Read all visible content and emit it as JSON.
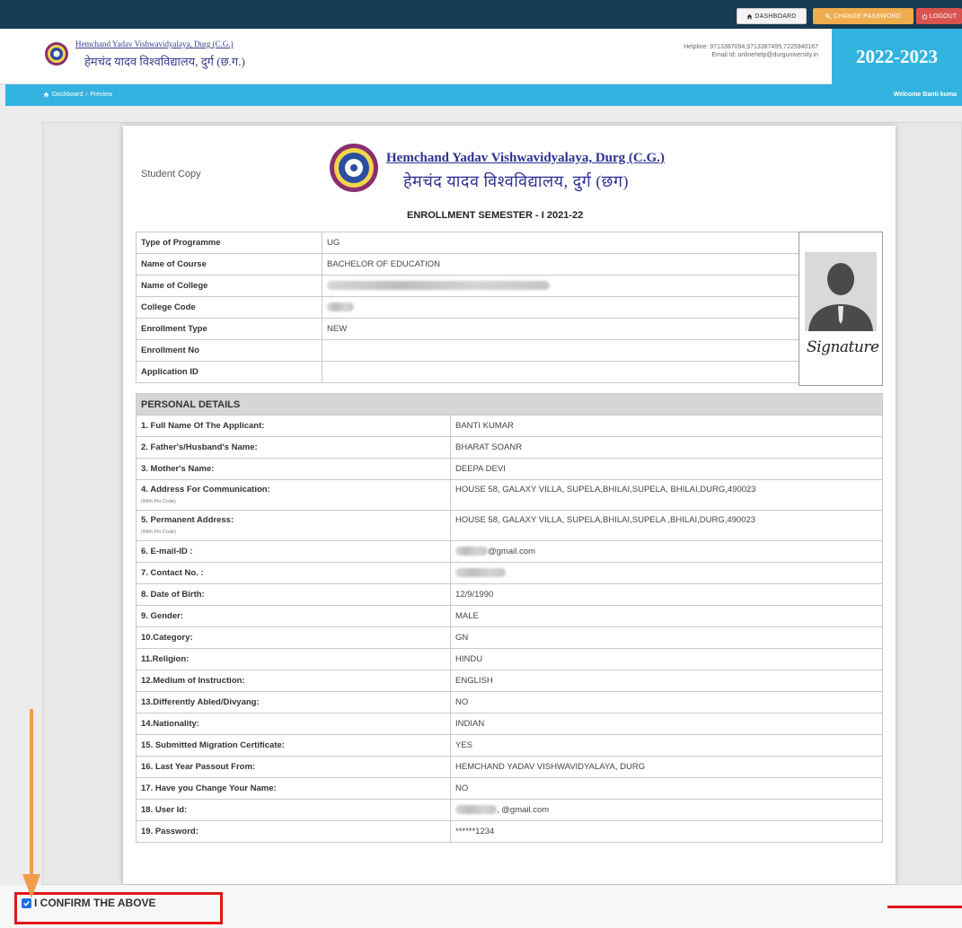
{
  "topbar": {
    "dashboard_label": "DASHBOARD",
    "change_password_label": "CHANGE PASSWORD",
    "logout_label": "LOGOUT"
  },
  "header": {
    "name_en": "Hemchand Yadav Vishwavidyalaya, Durg (C.G.)",
    "name_hi": "हेमचंद यादव विश्वविद्यालय, दुर्ग (छ.ग.)",
    "helpline": "Helpline: 9713387094,9713387495,7225940167",
    "email": "Email Id: onlinehelp@durguniversity.in",
    "year": "2022-2023"
  },
  "breadcrumb": {
    "items": [
      "Dashboard",
      "Preview"
    ],
    "separator": "/",
    "welcome": "Welcome Banti kuma"
  },
  "document": {
    "copy_label": "Student Copy",
    "university_en": "Hemchand Yadav Vishwavidyalaya, Durg (C.G.)",
    "university_hi": "हेमचंद यादव विश्वविद्यालय, दुर्ग (छग)",
    "semester": "ENROLLMENT SEMESTER - I 2021-22",
    "signature": "Signature",
    "info_rows": [
      {
        "label": "Type of Programme",
        "value": "UG"
      },
      {
        "label": "Name of Course",
        "value": "BACHELOR OF EDUCATION"
      },
      {
        "label": "Name of College",
        "value": ""
      },
      {
        "label": "College Code",
        "value": ""
      },
      {
        "label": "Enrollment Type",
        "value": "NEW"
      },
      {
        "label": "Enrollment No",
        "value": ""
      },
      {
        "label": "Application ID",
        "value": ""
      }
    ],
    "personal_heading": "PERSONAL DETAILS",
    "pin_note": "(With Pin Code)",
    "personal_rows": [
      {
        "label": "1. Full Name Of The Applicant:",
        "value": "BANTI  KUMAR"
      },
      {
        "label": "2. Father's/Husband's Name:",
        "value": "BHARAT SOANR"
      },
      {
        "label": "3. Mother's Name:",
        "value": "DEEPA DEVI"
      },
      {
        "label": "4. Address For Communication:",
        "value": "HOUSE 58, GALAXY VILLA, SUPELA,BHILAI,SUPELA, BHILAI,DURG,490023"
      },
      {
        "label": "5. Permanent Address:",
        "value": "HOUSE 58, GALAXY VILLA, SUPELA,BHILAI,SUPELA ,BHILAI,DURG,490023"
      },
      {
        "label": "6. E-mail-ID  :",
        "value": "@gmail.com"
      },
      {
        "label": "7. Contact No.  :",
        "value": ""
      },
      {
        "label": "8. Date of Birth:",
        "value": "12/9/1990"
      },
      {
        "label": "9. Gender:",
        "value": "MALE"
      },
      {
        "label": "10.Category:",
        "value": "GN"
      },
      {
        "label": "11.Religion:",
        "value": "HINDU"
      },
      {
        "label": "12.Medium of Instruction:",
        "value": "ENGLISH"
      },
      {
        "label": "13.Differently Abled/Divyang:",
        "value": "NO"
      },
      {
        "label": "14.Nationality:",
        "value": "INDIAN"
      },
      {
        "label": "15. Submitted Migration Certificate:",
        "value": "YES"
      },
      {
        "label": "16. Last Year Passout From:",
        "value": "HEMCHAND YADAV VISHWAVIDYALAYA, DURG"
      },
      {
        "label": "17. Have you Change Your Name:",
        "value": "NO"
      },
      {
        "label": "18. User Id:",
        "value": ", @gmail.com"
      },
      {
        "label": "19. Password:",
        "value": "******1234"
      }
    ]
  },
  "confirm": {
    "label": "I CONFIRM THE ABOVE",
    "checked": true
  },
  "colors": {
    "topbar": "#163b52",
    "accent": "#33b3df",
    "highlight": "#e11717",
    "arrow": "#f39c4a"
  }
}
